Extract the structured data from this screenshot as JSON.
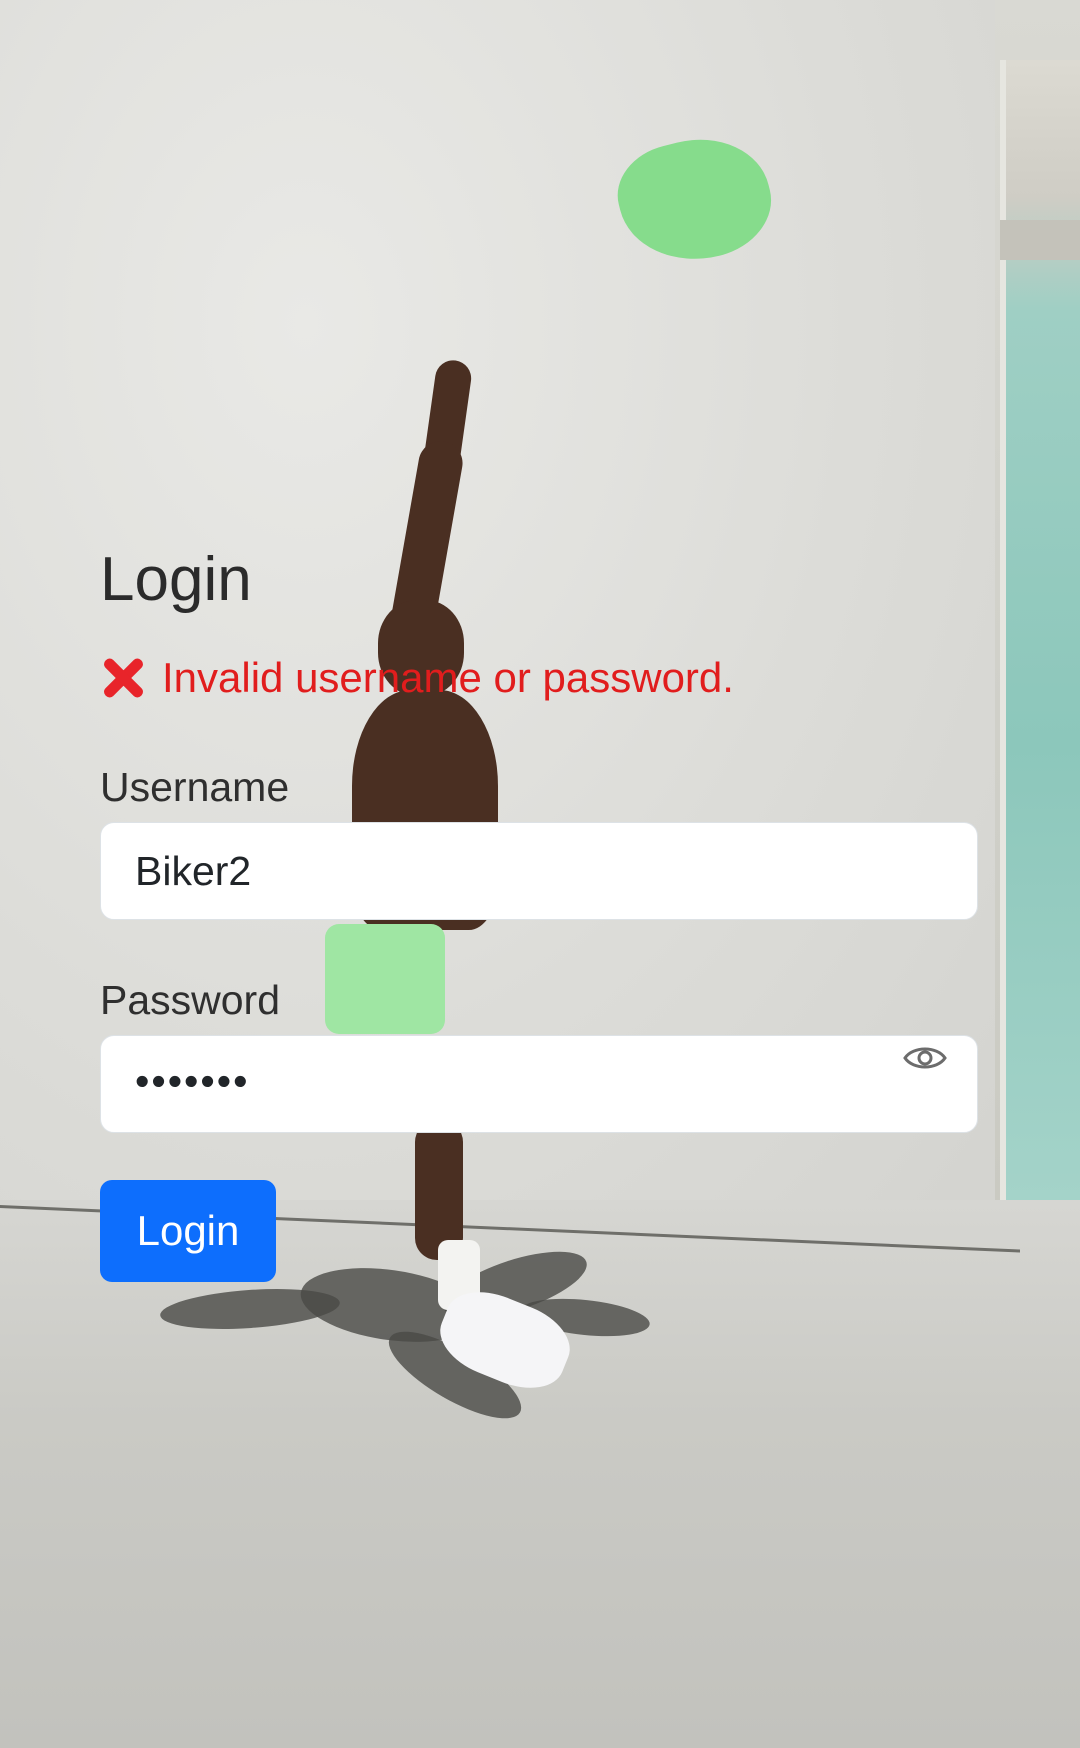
{
  "login": {
    "title": "Login",
    "error_message": "Invalid username or password.",
    "error_icon": "cross-mark-icon",
    "username_label": "Username",
    "username_value": "Biker2",
    "password_label": "Password",
    "password_masked": "•••••••",
    "password_toggle_icon": "eye-icon",
    "submit_label": "Login"
  },
  "colors": {
    "accent": "#0d6efd",
    "error": "#e11d1d",
    "input_bg": "#ffffff"
  },
  "background": {
    "description_icon": "photo-background"
  }
}
